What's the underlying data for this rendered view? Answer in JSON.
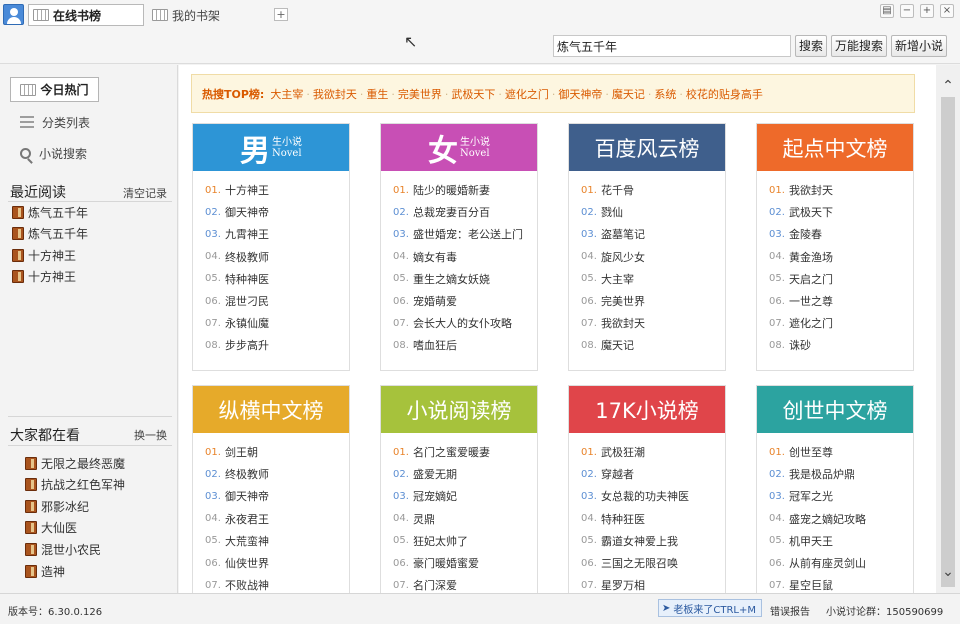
{
  "topbar": {
    "tabs": [
      {
        "label": "在线书榜"
      },
      {
        "label": "我的书架"
      }
    ],
    "add_tab": "+",
    "window_buttons": [
      "▤",
      "−",
      "+",
      "×"
    ],
    "search_value": "炼气五千年",
    "buttons": {
      "search": "搜索",
      "power_search": "万能搜索",
      "add_novel": "新增小说"
    }
  },
  "sidebar": {
    "today_hot": "今日热门",
    "category_list": "分类列表",
    "novel_search": "小说搜索",
    "recent": {
      "title": "最近阅读",
      "clear": "清空记录",
      "items": [
        "炼气五千年",
        "炼气五千年",
        "十方神王",
        "十方神王"
      ]
    },
    "watching": {
      "title": "大家都在看",
      "refresh": "换一换",
      "items": [
        "无限之最终恶魔",
        "抗战之红色军神",
        "邪影冰纪",
        "大仙医",
        "混世小农民",
        "造神"
      ]
    }
  },
  "hotbar": {
    "label": "热搜TOP榜:",
    "keywords": [
      "大主宰",
      "我欲封天",
      "重生",
      "完美世界",
      "武极天下",
      "遮化之门",
      "御天神帝",
      "魔天记",
      "系统",
      "校花的贴身高手"
    ]
  },
  "boards": [
    {
      "name": "男生小说",
      "title_big": "男",
      "title_small": "生小说",
      "title_en": "Novel",
      "color": "#2d95d6",
      "items": [
        "十方神王",
        "御天神帝",
        "九霄神王",
        "终极教师",
        "特种神医",
        "混世刁民",
        "永镇仙魔",
        "步步高升"
      ]
    },
    {
      "name": "女生小说",
      "title_big": "女",
      "title_small": "生小说",
      "title_en": "Novel",
      "color": "#c84fb5",
      "items": [
        "陆少的暖婚新妻",
        "总裁宠妻百分百",
        "盛世婚宠：老公送上门",
        "嫡女有毒",
        "重生之嫡女妖娆",
        "宠婚萌爱",
        "会长大人的女仆攻略",
        "嗜血狂后"
      ]
    },
    {
      "name": "百度风云榜",
      "color": "#3f5f8c",
      "items": [
        "花千骨",
        "戮仙",
        "盗墓笔记",
        "旋风少女",
        "大主宰",
        "完美世界",
        "我欲封天",
        "魔天记"
      ]
    },
    {
      "name": "起点中文榜",
      "color": "#ee6a2a",
      "items": [
        "我欲封天",
        "武极天下",
        "金陵春",
        "黄金渔场",
        "天启之门",
        "一世之尊",
        "遮化之门",
        "诛砂"
      ]
    },
    {
      "name": "纵横中文榜",
      "color": "#e6aa2a",
      "items": [
        "剑王朝",
        "终极教师",
        "御天神帝",
        "永夜君王",
        "大荒蛮神",
        "仙侠世界",
        "不败战神"
      ]
    },
    {
      "name": "小说阅读榜",
      "color": "#a6c23c",
      "items": [
        "名门之蜜爱暖妻",
        "盛爱无期",
        "冠宠嫡妃",
        "灵鼎",
        "狂妃太帅了",
        "豪门暖婚蜜爱",
        "名门深爱"
      ]
    },
    {
      "name": "17K小说榜",
      "color": "#e0454a",
      "items": [
        "武极狂潮",
        "穿越者",
        "女总裁的功夫神医",
        "特种狂医",
        "霸道女神爱上我",
        "三国之无限召唤",
        "星罗万相"
      ]
    },
    {
      "name": "创世中文榜",
      "color": "#2ca3a0",
      "items": [
        "创世至尊",
        "我是极品炉鼎",
        "冠军之光",
        "盛宠之嫡妃攻略",
        "机甲天王",
        "从前有座灵剑山",
        "星空巨鼠"
      ]
    }
  ],
  "status": {
    "version": "版本号：6.30.0.126",
    "boss": "老板来了CTRL+M",
    "report": "错误报告",
    "group": "小说讨论群：150590699"
  }
}
